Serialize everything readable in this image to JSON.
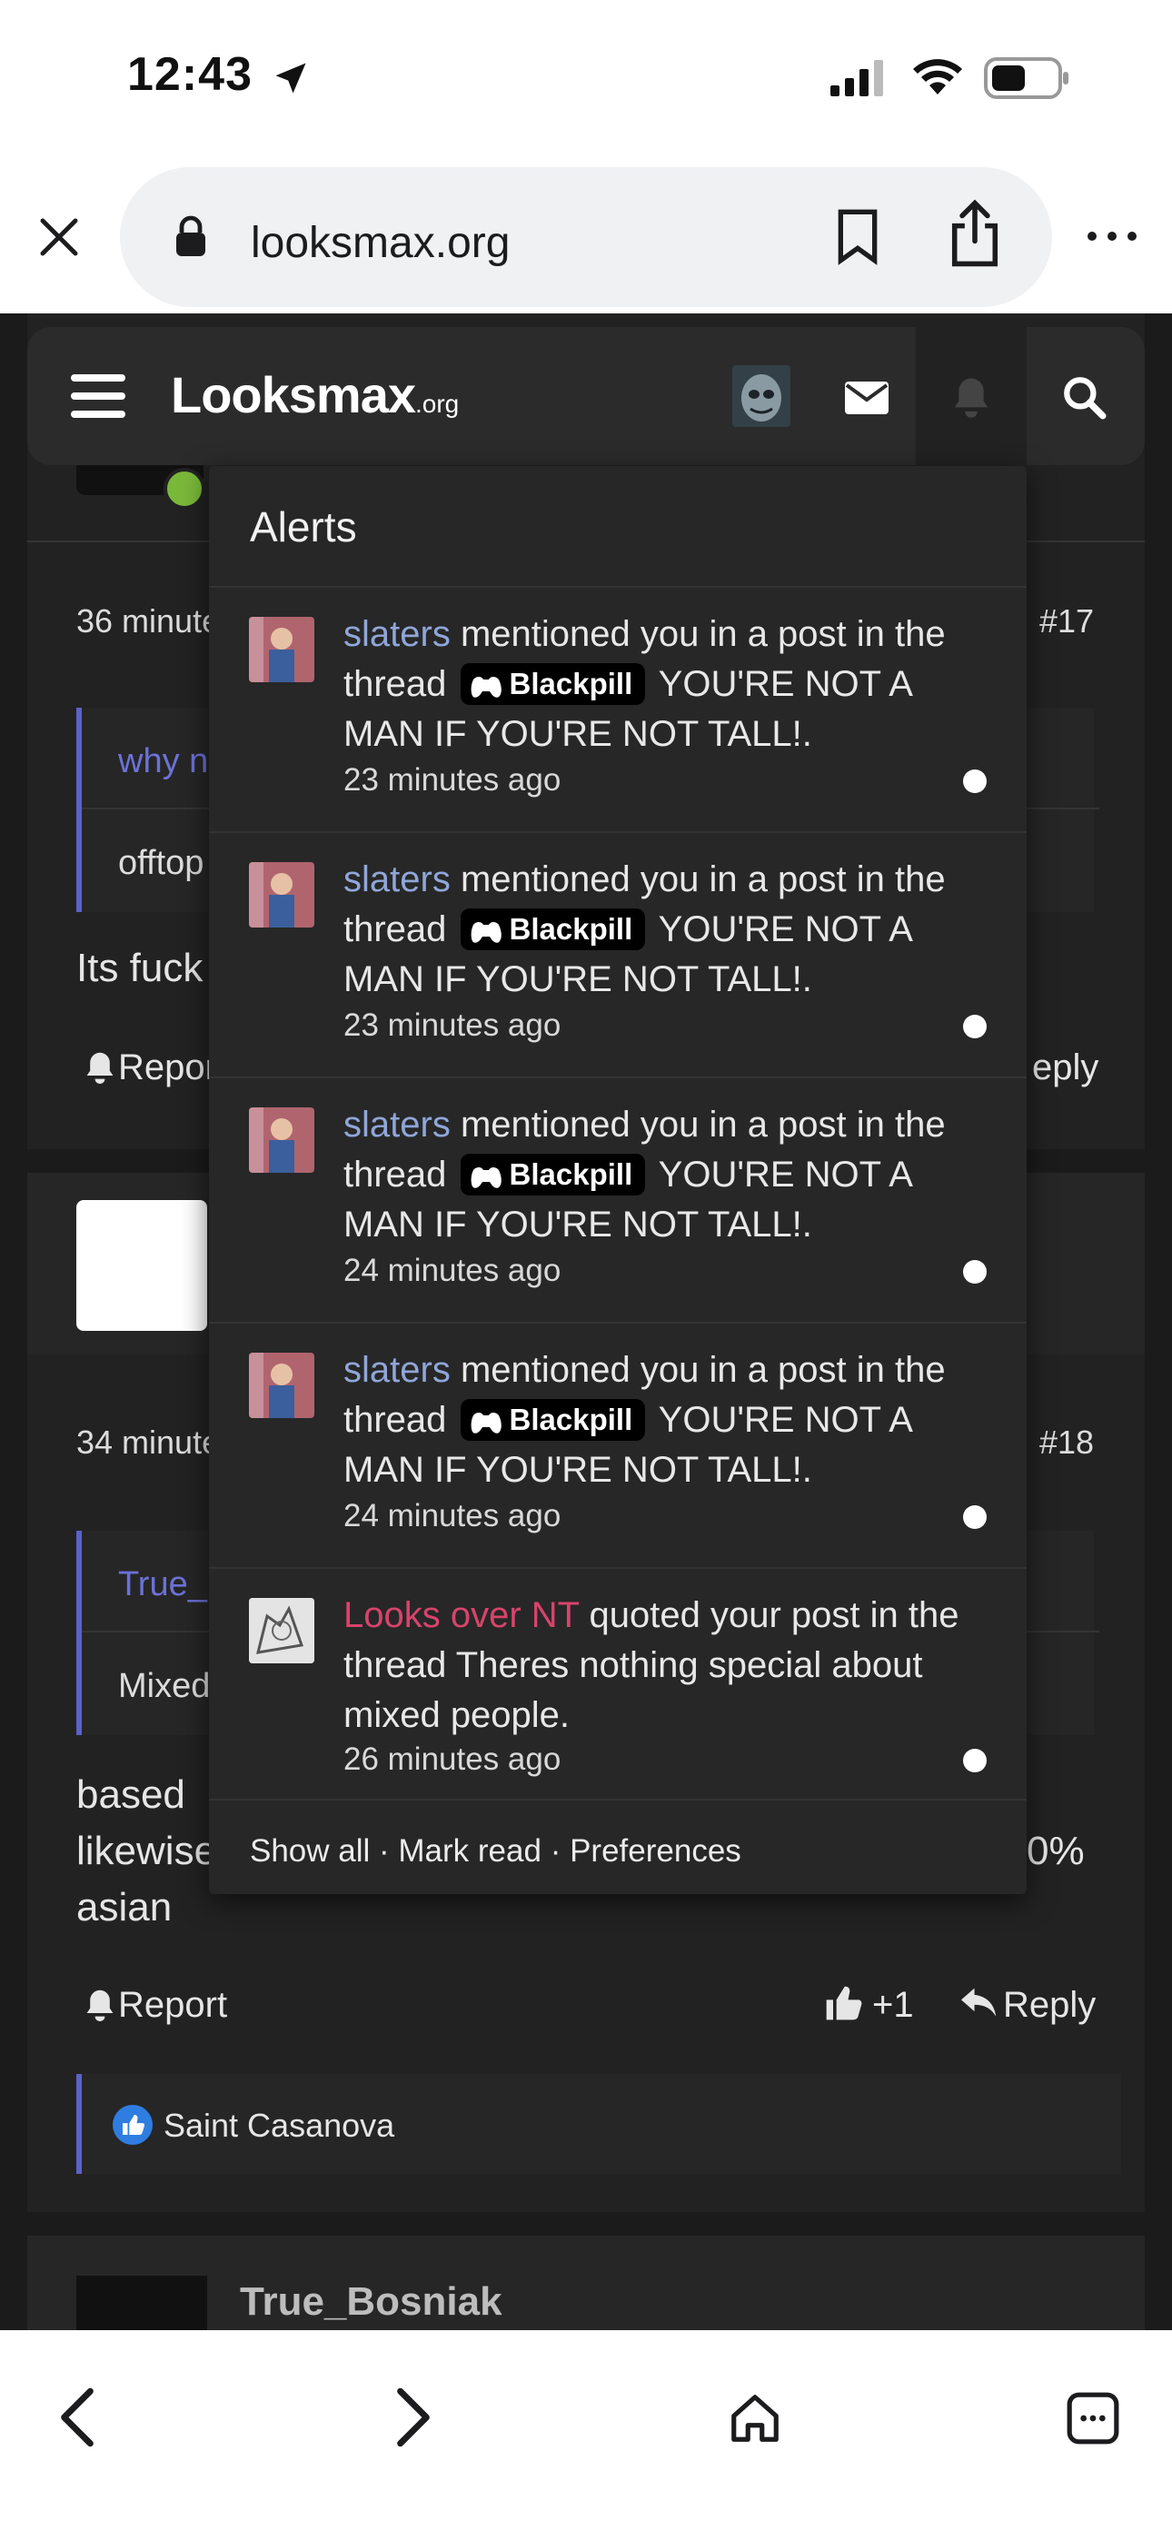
{
  "status_bar": {
    "time": "12:43"
  },
  "browser": {
    "url": "looksmax.org"
  },
  "site": {
    "logo_main": "Looksmax",
    "logo_suffix": ".org"
  },
  "posts": [
    {
      "time_partial": "36 minute",
      "number": "#17",
      "quote_author_partial": "why n",
      "quote_text_partial": "offtop",
      "body_partial": "Its fuck",
      "report_partial": "Repor",
      "reply_partial": "eply"
    },
    {
      "time_partial": "34 minute",
      "number": "#18",
      "quote_author_partial": "True_B",
      "quote_text_partial": "Mixed",
      "body_lines": [
        "based",
        "likewise",
        "asian"
      ],
      "body_right_partial": "0%",
      "report": "Report",
      "like_count": "+1",
      "reply": "Reply",
      "reaction_user": "Saint Casanova"
    },
    {
      "author": "True_Bosniak"
    }
  ],
  "alerts": {
    "title": "Alerts",
    "items": [
      {
        "user": "slaters",
        "action": "mentioned you in a post in the thread",
        "tag": "Blackpill",
        "thread": "YOU'RE NOT A MAN IF YOU'RE NOT TALL!.",
        "time": "23 minutes ago"
      },
      {
        "user": "slaters",
        "action": "mentioned you in a post in the thread",
        "tag": "Blackpill",
        "thread": "YOU'RE NOT A MAN IF YOU'RE NOT TALL!.",
        "time": "23 minutes ago"
      },
      {
        "user": "slaters",
        "action": "mentioned you in a post in the thread",
        "tag": "Blackpill",
        "thread": "YOU'RE NOT A MAN IF YOU'RE NOT TALL!.",
        "time": "24 minutes ago"
      },
      {
        "user": "slaters",
        "action": "mentioned you in a post in the thread",
        "tag": "Blackpill",
        "thread": "YOU'RE NOT A MAN IF YOU'RE NOT TALL!.",
        "time": "24 minutes ago"
      },
      {
        "user": "Looks over NT",
        "action": "quoted your post in the thread Theres nothing special about mixed people.",
        "time": "26 minutes ago"
      }
    ],
    "footer": {
      "show_all": "Show all",
      "mark_read": "Mark read",
      "preferences": "Preferences",
      "separator": " · "
    }
  },
  "colors": {
    "accent_blue": "#5c62c7",
    "mention_user": "#8fa6d8",
    "quote_user": "#d8436c",
    "page_bg": "#1b1b1b",
    "dropdown_bg": "#272727"
  }
}
